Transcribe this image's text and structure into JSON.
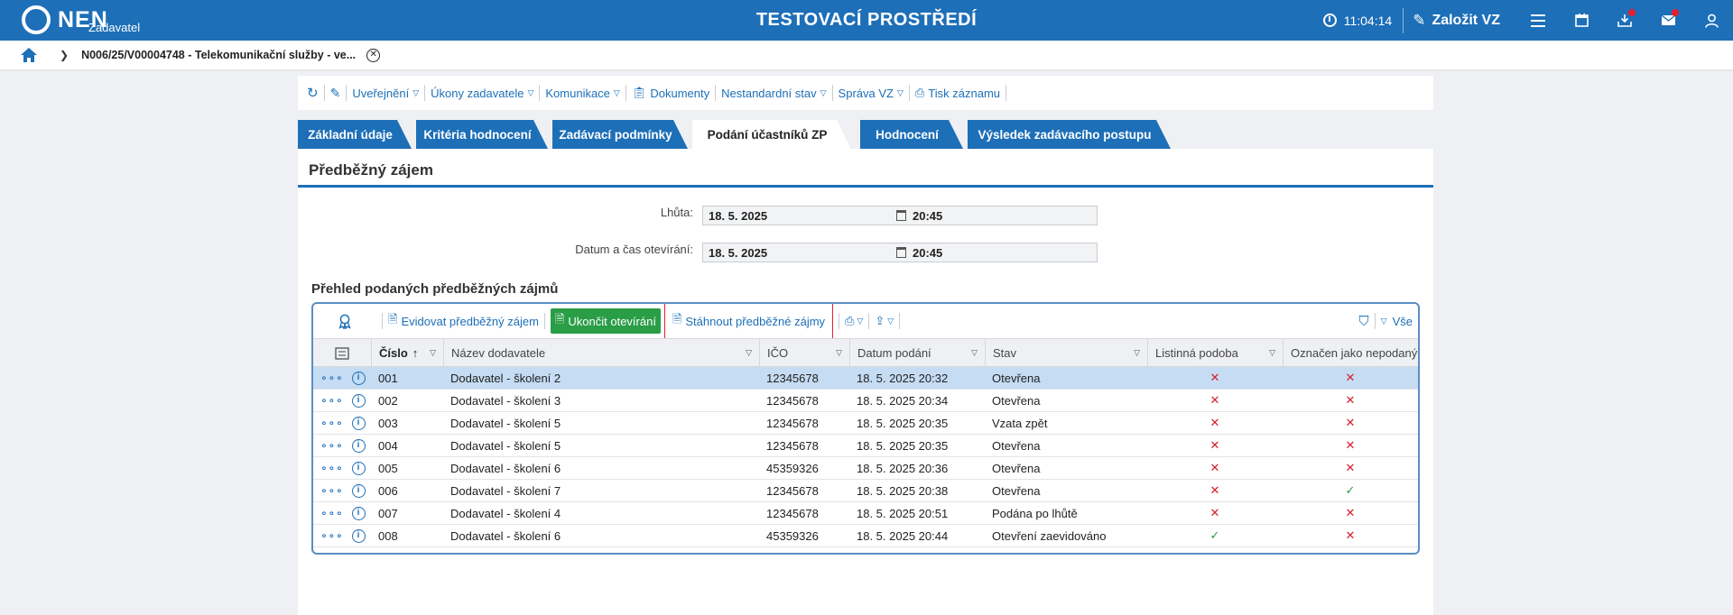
{
  "topbar": {
    "logo": "NEN",
    "logo_sub": "Zadavatel",
    "env_title": "TESTOVACÍ PROSTŘEDÍ",
    "time": "11:04:14",
    "create_label": "Založit VZ"
  },
  "breadcrumb": {
    "text": "N006/25/V00004748 - Telekomunikační služby - ve..."
  },
  "actions": {
    "publish": "Uveřejnění",
    "acts": "Úkony zadavatele",
    "communication": "Komunikace",
    "documents": "Dokumenty",
    "nonstandard": "Nestandardní stav",
    "management": "Správa VZ",
    "print": "Tisk záznamu"
  },
  "tabs": [
    {
      "label": "Základní údaje"
    },
    {
      "label": "Kritéria hodnocení"
    },
    {
      "label": "Zadávací podmínky"
    },
    {
      "label": "Podání účastníků ZP"
    },
    {
      "label": "Hodnocení"
    },
    {
      "label": "Výsledek zadávacího postupu"
    }
  ],
  "panel": {
    "title": "Předběžný zájem",
    "deadline_label": "Lhůta:",
    "deadline_date": "18. 5. 2025",
    "deadline_time": "20:45",
    "opening_label": "Datum a čas otevírání:",
    "opening_date": "18. 5. 2025",
    "opening_time": "20:45",
    "section_title": "Přehled podaných předběžných zájmů"
  },
  "grid_toolbar": {
    "record": "Evidovat předběžný zájem",
    "finish": "Ukončit otevírání",
    "download": "Stáhnout předběžné zájmy",
    "all": "Vše"
  },
  "columns": {
    "number": "Číslo",
    "supplier": "Název dodavatele",
    "ico": "IČO",
    "date": "Datum podání",
    "state": "Stav",
    "paper": "Listinná podoba",
    "undelivered": "Označen jako nepodaný"
  },
  "rows": [
    {
      "number": "001",
      "supplier": "Dodavatel - školení 2",
      "ico": "12345678",
      "date": "18. 5. 2025 20:32",
      "state": "Otevřena",
      "paper": "✕",
      "undelivered": "✕"
    },
    {
      "number": "002",
      "supplier": "Dodavatel - školení 3",
      "ico": "12345678",
      "date": "18. 5. 2025 20:34",
      "state": "Otevřena",
      "paper": "✕",
      "undelivered": "✕"
    },
    {
      "number": "003",
      "supplier": "Dodavatel - školení 5",
      "ico": "12345678",
      "date": "18. 5. 2025 20:35",
      "state": "Vzata zpět",
      "paper": "✕",
      "undelivered": "✕"
    },
    {
      "number": "004",
      "supplier": "Dodavatel - školení 5",
      "ico": "12345678",
      "date": "18. 5. 2025 20:35",
      "state": "Otevřena",
      "paper": "✕",
      "undelivered": "✕"
    },
    {
      "number": "005",
      "supplier": "Dodavatel - školení 6",
      "ico": "45359326",
      "date": "18. 5. 2025 20:36",
      "state": "Otevřena",
      "paper": "✕",
      "undelivered": "✕"
    },
    {
      "number": "006",
      "supplier": "Dodavatel - školení 7",
      "ico": "12345678",
      "date": "18. 5. 2025 20:38",
      "state": "Otevřena",
      "paper": "✕",
      "undelivered": "✓"
    },
    {
      "number": "007",
      "supplier": "Dodavatel - školení 4",
      "ico": "12345678",
      "date": "18. 5. 2025 20:51",
      "state": "Podána po lhůtě",
      "paper": "✕",
      "undelivered": "✕"
    },
    {
      "number": "008",
      "supplier": "Dodavatel - školení 6",
      "ico": "45359326",
      "date": "18. 5. 2025 20:44",
      "state": "Otevření zaevidováno",
      "paper": "✓",
      "undelivered": "✕"
    }
  ],
  "colors": {
    "brand": "#1d6fb8",
    "selected_row": "#c5dcf3",
    "green": "#2a9d47",
    "red": "#d3202b"
  }
}
